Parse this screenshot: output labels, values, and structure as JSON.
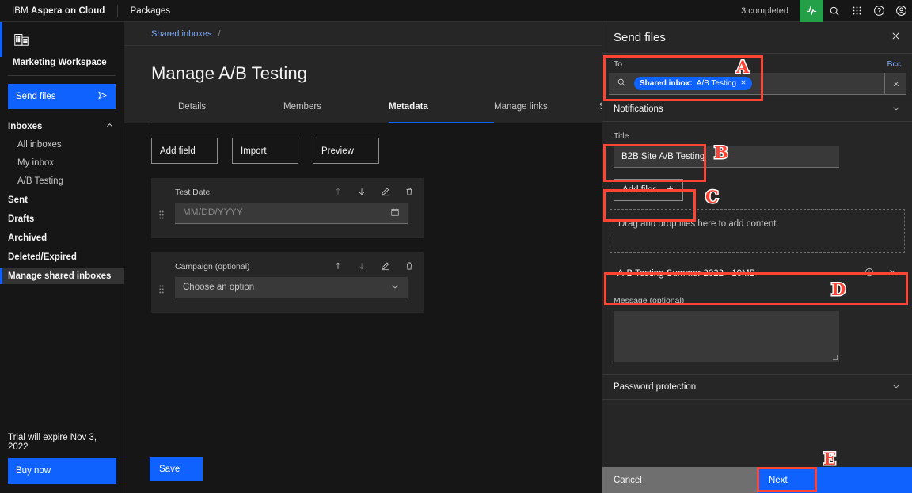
{
  "topbar": {
    "brand_prefix": "IBM ",
    "brand_name": "Aspera on Cloud",
    "packages": "Packages",
    "completed": "3 completed",
    "icons": [
      "activity-icon",
      "search-icon",
      "app-switcher-icon",
      "help-icon",
      "account-icon"
    ]
  },
  "sidebar": {
    "workspace": "Marketing Workspace",
    "send_files": "Send files",
    "inboxes_group": "Inboxes",
    "inbox_children": [
      {
        "label": "All inboxes"
      },
      {
        "label": "My inbox"
      },
      {
        "label": "A/B Testing"
      }
    ],
    "items": [
      {
        "label": "Sent",
        "active": false
      },
      {
        "label": "Drafts",
        "active": false
      },
      {
        "label": "Archived",
        "active": false
      },
      {
        "label": "Deleted/Expired",
        "active": false
      },
      {
        "label": "Manage shared inboxes",
        "active": true
      }
    ],
    "trial_text": "Trial will expire Nov 3, 2022",
    "buy_now": "Buy now"
  },
  "main": {
    "breadcrumb_link": "Shared inboxes",
    "breadcrumb_separator": "/",
    "page_title": "Manage A/B Testing",
    "tabs": [
      {
        "label": "Details",
        "active": false
      },
      {
        "label": "Members",
        "active": false
      },
      {
        "label": "Metadata",
        "active": true
      },
      {
        "label": "Manage links",
        "active": false
      },
      {
        "label": "Se",
        "active": false
      }
    ],
    "actions": [
      {
        "label": "Add field"
      },
      {
        "label": "Import"
      },
      {
        "label": "Preview"
      }
    ],
    "fields": [
      {
        "label": "Test Date",
        "value": "MM/DD/YYYY",
        "type": "date",
        "trailing_icon": "calendar-icon",
        "up_enabled": false,
        "down_enabled": true
      },
      {
        "label": "Campaign (optional)",
        "value": "Choose an option",
        "type": "select",
        "trailing_icon": "chevron-down-icon",
        "up_enabled": true,
        "down_enabled": false
      }
    ],
    "save_label": "Save"
  },
  "panel": {
    "title": "Send files",
    "close_icon": "close-icon",
    "to_label": "To",
    "bcc_label": "Bcc",
    "search_icon": "search-icon",
    "chip_prefix": "Shared inbox:",
    "chip_value": "A/B Testing",
    "clear_icon": "close-icon",
    "notifications_label": "Notifications",
    "title_field_label": "Title",
    "title_field_value": "B2B Site A/B Testing",
    "add_files_label": "Add files",
    "add_files_icon": "plus-icon",
    "dropzone_text": "Drag and drop files here to add content",
    "file": {
      "name": "A-B Testing Summer 2022 - 10MB",
      "info_icon": "info-icon",
      "remove_icon": "close-icon"
    },
    "message_label": "Message (optional)",
    "message_value": "",
    "password_label": "Password protection",
    "cancel_label": "Cancel",
    "next_label": "Next"
  },
  "annotations": [
    {
      "letter": "A"
    },
    {
      "letter": "B"
    },
    {
      "letter": "C"
    },
    {
      "letter": "D"
    },
    {
      "letter": "E"
    }
  ],
  "colors": {
    "accent_blue": "#0f62fe",
    "link_blue": "#78a9ff",
    "green": "#24a148",
    "annotation_red": "#ff4433",
    "panel_bg": "#262626",
    "page_bg": "#161616"
  }
}
